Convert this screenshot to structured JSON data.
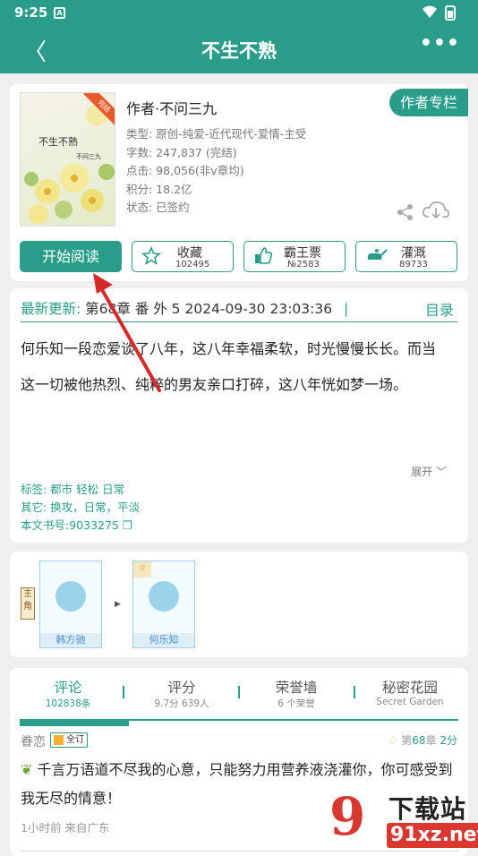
{
  "status": {
    "time": "9:25",
    "app_glyph": "A"
  },
  "nav": {
    "back": "〈",
    "title": "不生不熟",
    "more": "•••"
  },
  "book": {
    "cover_title": "不生不熟",
    "cover_author": "不问三九",
    "cover_badge": "完结",
    "author": "作者·不问三九",
    "type": "类型: 原创-纯爱-近代现代-爱情-主受",
    "words": "字数: 247,837 (完结)",
    "clicks": "点击: 98,056(非v章均)",
    "score": "积分: 18.2亿",
    "state": "状态: 已签约",
    "author_column": "作者专栏"
  },
  "actions": {
    "read": "开始阅读",
    "collect_label": "收藏",
    "collect_count": "102495",
    "vote_label": "霸王票",
    "vote_count": "№2583",
    "water_label": "灌溉",
    "water_count": "89733"
  },
  "update": {
    "label": "最新更新:",
    "text": "第68章  番  外  5  2024-09-30 23:03:36",
    "sep": "|",
    "catalog": "目录"
  },
  "description": "何乐知一段恋爱谈了八年，这八年幸福柔软，时光慢慢长长。而当这一切被他热烈、纯粹的男友亲口打碎，这八年恍如梦一场。",
  "expand": "展开",
  "tags": {
    "tags_line": "标签: 都市 轻松 日常",
    "other_line": "其它: 换攻，日常，平淡",
    "id_line": "本文书号:9033275"
  },
  "characters": {
    "role_label": "主角",
    "list": [
      {
        "name": "韩方驰"
      },
      {
        "name": "何乐知"
      }
    ]
  },
  "tabs": [
    {
      "label": "评论",
      "sub": "102838条"
    },
    {
      "label": "评分",
      "sub": "9.7分 639人"
    },
    {
      "label": "荣誉墙",
      "sub": "6 个荣誉"
    },
    {
      "label": "秘密花园",
      "sub": "Secret Garden"
    }
  ],
  "comment": {
    "user": "眷恋",
    "badge": "全订",
    "chapter_prefix": "第",
    "chapter_num": "68",
    "chapter_suffix": "章",
    "score": "2分",
    "text": "千言万语道不尽我的心意，只能努力用营养液浇灌你，你可感受到我无尽的情意！",
    "time": "1小时前  来自广东"
  },
  "watermark": {
    "big": "9",
    "line1": "下载站",
    "line2": "91xz.net"
  },
  "colors": {
    "accent": "#2a9c8a",
    "arrow": "#d42a2a"
  }
}
